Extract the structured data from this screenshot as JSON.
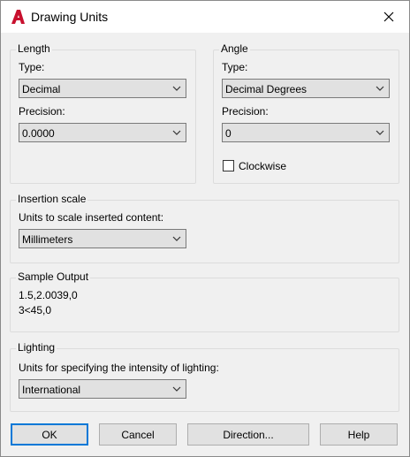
{
  "window": {
    "title": "Drawing Units",
    "app_icon": "autocad-icon",
    "close_icon": "close-icon"
  },
  "length": {
    "group_title": "Length",
    "type_label": "Type:",
    "type_value": "Decimal",
    "precision_label": "Precision:",
    "precision_value": "0.0000"
  },
  "angle": {
    "group_title": "Angle",
    "type_label": "Type:",
    "type_value": "Decimal Degrees",
    "precision_label": "Precision:",
    "precision_value": "0",
    "clockwise_label": "Clockwise",
    "clockwise_checked": false
  },
  "insertion": {
    "group_title": "Insertion scale",
    "units_label": "Units to scale inserted content:",
    "units_value": "Millimeters"
  },
  "sample": {
    "group_title": "Sample Output",
    "line1": "1.5,2.0039,0",
    "line2": "3<45,0"
  },
  "lighting": {
    "group_title": "Lighting",
    "units_label": "Units for specifying the intensity of lighting:",
    "units_value": "International"
  },
  "buttons": {
    "ok": "OK",
    "cancel": "Cancel",
    "direction": "Direction...",
    "help": "Help"
  },
  "colors": {
    "accent": "#0078d7",
    "brand_red": "#c8102e"
  }
}
